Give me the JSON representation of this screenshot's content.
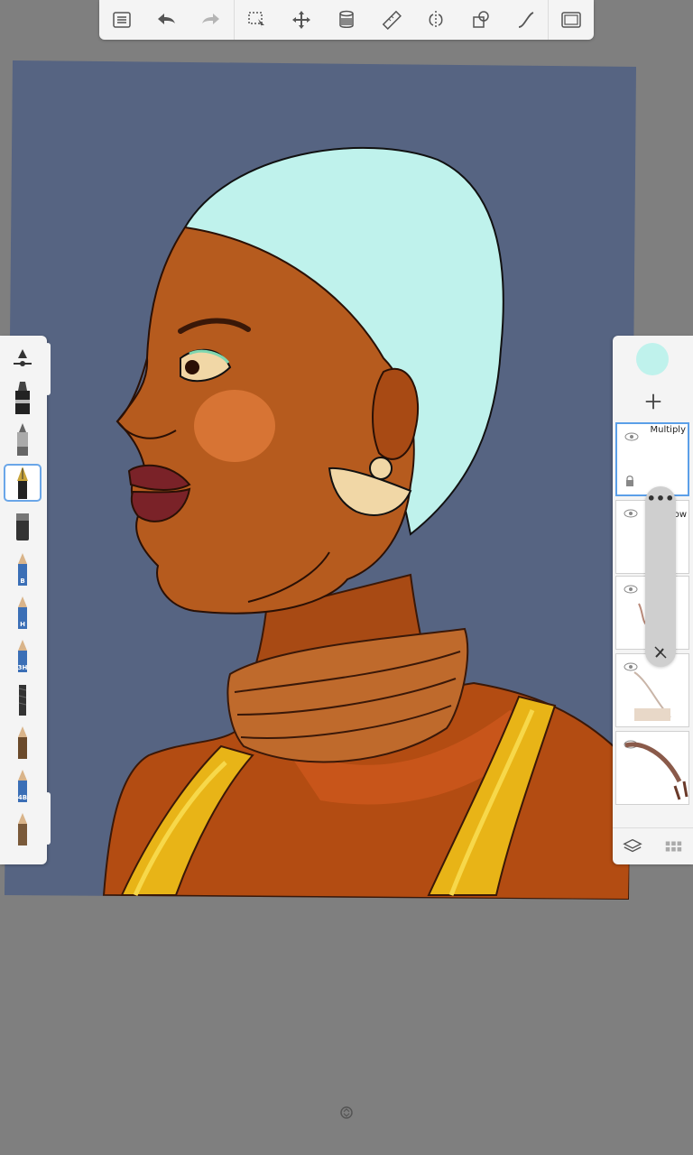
{
  "toolbar": {
    "items": [
      {
        "name": "menu-list-icon"
      },
      {
        "name": "undo-icon"
      },
      {
        "name": "redo-icon"
      },
      {
        "name": "selection-icon"
      },
      {
        "name": "transform-move-icon"
      },
      {
        "name": "fill-bucket-icon"
      },
      {
        "name": "ruler-icon"
      },
      {
        "name": "symmetry-icon"
      },
      {
        "name": "shapes-icon"
      },
      {
        "name": "curve-icon"
      },
      {
        "name": "fullscreen-icon"
      }
    ]
  },
  "brushes": {
    "items": [
      {
        "name": "brush-size-slider",
        "badge": ""
      },
      {
        "name": "brush-marker",
        "badge": ""
      },
      {
        "name": "brush-airbrush",
        "badge": ""
      },
      {
        "name": "brush-fountain-pen",
        "badge": "",
        "selected": true
      },
      {
        "name": "brush-ink-marker",
        "badge": ""
      },
      {
        "name": "brush-pencil-b",
        "badge": "B"
      },
      {
        "name": "brush-pencil-h",
        "badge": "H"
      },
      {
        "name": "brush-pencil-3h",
        "badge": "3H"
      },
      {
        "name": "brush-charcoal",
        "badge": ""
      },
      {
        "name": "brush-pencil-plain",
        "badge": ""
      },
      {
        "name": "brush-pencil-4b",
        "badge": "4B"
      },
      {
        "name": "brush-pencil-soft",
        "badge": ""
      }
    ]
  },
  "layers": {
    "current_color": "#bff2ec",
    "items": [
      {
        "blend": "Multiply",
        "active": true
      },
      {
        "blend": "ow",
        "active": false
      },
      {
        "blend": "",
        "active": false
      },
      {
        "blend": "",
        "active": false
      },
      {
        "blend": "",
        "active": false
      }
    ],
    "opacity_dots": "•••"
  },
  "colors": {
    "canvas_bg": "#566482",
    "hair": "#bff2ec",
    "skin": "#b65b1e",
    "skin_light": "#e07a3a",
    "lips": "#7a2228",
    "earring": "#f1d7a6",
    "dress": "#b34c12",
    "strap": "#e8b417"
  }
}
